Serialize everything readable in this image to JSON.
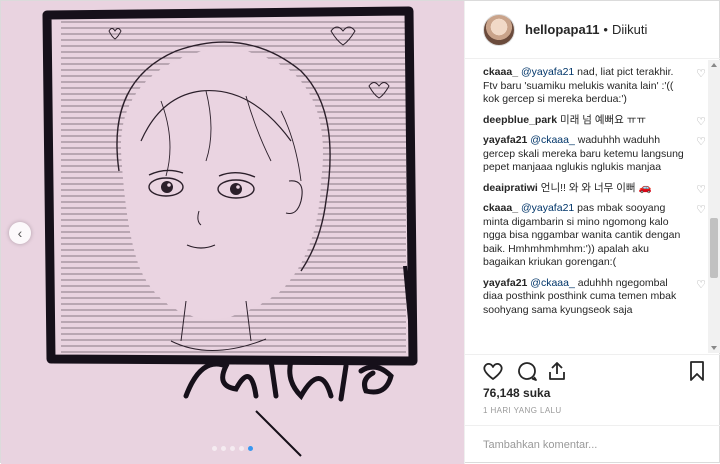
{
  "post": {
    "media": {
      "slide_count": 5,
      "active_slide": 5
    },
    "header": {
      "username": "hellopapa11",
      "separator": "•",
      "follow_status": "Diikuti"
    },
    "comments": [
      {
        "user": "ckaaa_",
        "mention": "@yayafa21",
        "text": "nad, liat pict terakhir. Ftv baru 'suamiku melukis wanita lain' :'(( kok gercep si mereka berdua:')"
      },
      {
        "user": "deepblue_park",
        "mention": "",
        "text": "미래 넘 예뻐요 ㅠㅠ"
      },
      {
        "user": "yayafa21",
        "mention": "@ckaaa_",
        "text": "waduhhh waduhh gercep skali mereka baru ketemu langsung pepet manjaaa nglukis nglukis manjaa"
      },
      {
        "user": "deaipratiwi",
        "mention": "",
        "text": "언니!! 와 와 너무 이뻐 🚗"
      },
      {
        "user": "ckaaa_",
        "mention": "@yayafa21",
        "text": "pas mbak sooyang minta digambarin si mino ngomong kalo ngga bisa nggambar wanita cantik dengan baik. Hmhmhmhmhm:')) apalah aku bagaikan kriukan gorengan:("
      },
      {
        "user": "yayafa21",
        "mention": "@ckaaa_",
        "text": "aduhhh ngegombal diaa posthink posthink cuma temen mbak soohyang sama kyungseok saja"
      }
    ],
    "likes_text": "76,148 suka",
    "timestamp": "1 HARI YANG LALU",
    "add_comment_placeholder": "Tambahkan komentar..."
  }
}
